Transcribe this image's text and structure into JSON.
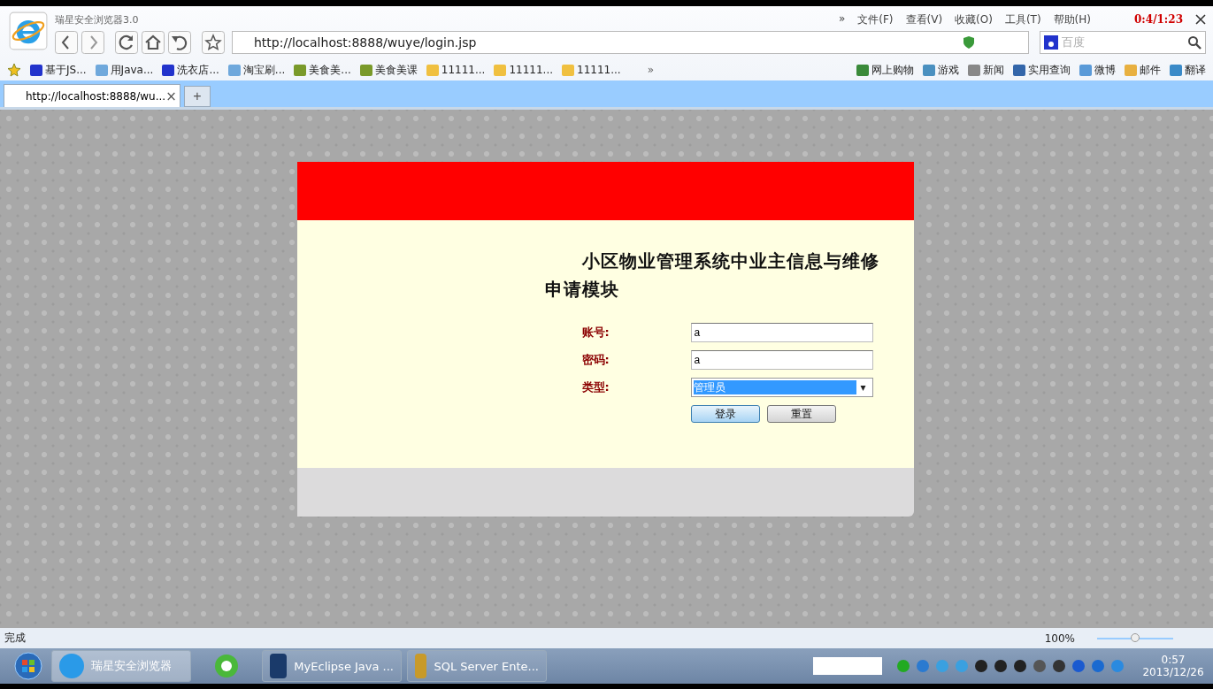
{
  "browser": {
    "title": "瑞星安全浏览器3.0",
    "menu": [
      "»",
      "文件(F)",
      "查看(V)",
      "收藏(O)",
      "工具(T)",
      "帮助(H)"
    ],
    "recorder_time": "0:4/1:23",
    "address": "http://localhost:8888/wuye/login.jsp",
    "search_placeholder": "百度"
  },
  "bookmarks": [
    {
      "label": "基于JS...",
      "kind": "paw"
    },
    {
      "label": "用Java...",
      "kind": "page"
    },
    {
      "label": "洗衣店...",
      "kind": "paw"
    },
    {
      "label": "淘宝刷...",
      "kind": "page"
    },
    {
      "label": "美食美...",
      "kind": "video"
    },
    {
      "label": "美食美课",
      "kind": "video"
    },
    {
      "label": "11111...",
      "kind": "folder"
    },
    {
      "label": "11111...",
      "kind": "folder"
    },
    {
      "label": "11111...",
      "kind": "folder"
    }
  ],
  "bookmarks_more": "»",
  "quick_links": [
    {
      "label": "网上购物",
      "kind": "cart"
    },
    {
      "label": "游戏",
      "kind": "game"
    },
    {
      "label": "新闻",
      "kind": "news"
    },
    {
      "label": "实用查询",
      "kind": "search"
    },
    {
      "label": "微博",
      "kind": "chat"
    },
    {
      "label": "邮件",
      "kind": "mail"
    },
    {
      "label": "翻译",
      "kind": "translate"
    }
  ],
  "tabs": [
    {
      "label": "http://localhost:8888/wu...",
      "close": "×",
      "selected": true
    }
  ],
  "new_tab": "+",
  "page": {
    "title": "小区物业管理系统中业主信息与维修申请模块",
    "fields": [
      {
        "label": "账号:",
        "kind": "text",
        "value": "a"
      },
      {
        "label": "密码:",
        "kind": "text",
        "value": "a"
      },
      {
        "label": "类型:",
        "kind": "select",
        "value": "管理员",
        "caret": "▾"
      }
    ],
    "buttons": [
      {
        "label": "登录",
        "focused": true
      },
      {
        "label": "重置",
        "focused": false
      }
    ]
  },
  "status_bar": {
    "text": "完成",
    "zoom": "100%",
    "level": 0.5
  },
  "taskbar": {
    "items": [
      {
        "label": "瑞星安全浏览器",
        "kind": "ie",
        "selected": true
      },
      {
        "kind": "green"
      },
      {
        "label": "MyEclipse Java ...",
        "kind": "eclipse",
        "selected": false
      },
      {
        "label": "SQL Server Ente...",
        "kind": "sql",
        "selected": false
      }
    ],
    "time": "0:57",
    "date": "2013/12/26"
  }
}
